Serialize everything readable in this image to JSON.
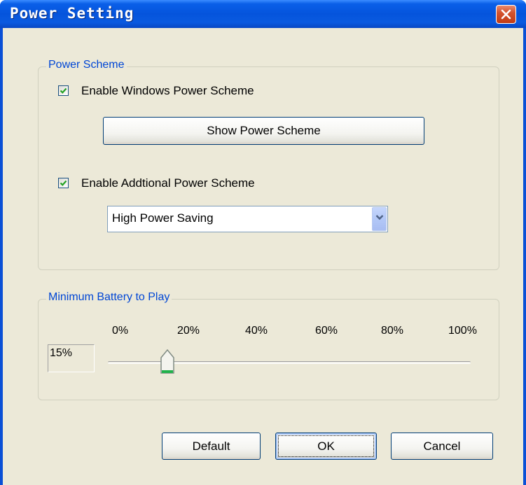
{
  "window": {
    "title": "Power Setting"
  },
  "power_scheme": {
    "group_title": "Power Scheme",
    "enable_windows_label": "Enable Windows Power Scheme",
    "enable_windows_checked": true,
    "show_button_label": "Show Power Scheme",
    "enable_additional_label": "Enable Addtional Power Scheme",
    "enable_additional_checked": true,
    "dropdown_value": "High Power Saving"
  },
  "battery": {
    "group_title": "Minimum Battery to Play",
    "value_text": "15%",
    "value": 15,
    "ticks": [
      "0%",
      "20%",
      "40%",
      "60%",
      "80%",
      "100%"
    ]
  },
  "buttons": {
    "default_label": "Default",
    "ok_label": "OK",
    "cancel_label": "Cancel"
  },
  "icons": {
    "close": "close-icon",
    "check": "check-icon",
    "dropdown": "chevron-down-icon",
    "slider_thumb": "slider-thumb"
  },
  "colors": {
    "titlebar": "#0554dc",
    "client": "#ece9d8",
    "group_title": "#0046d5",
    "check": "#21a121",
    "close_button": "#d4532f"
  }
}
